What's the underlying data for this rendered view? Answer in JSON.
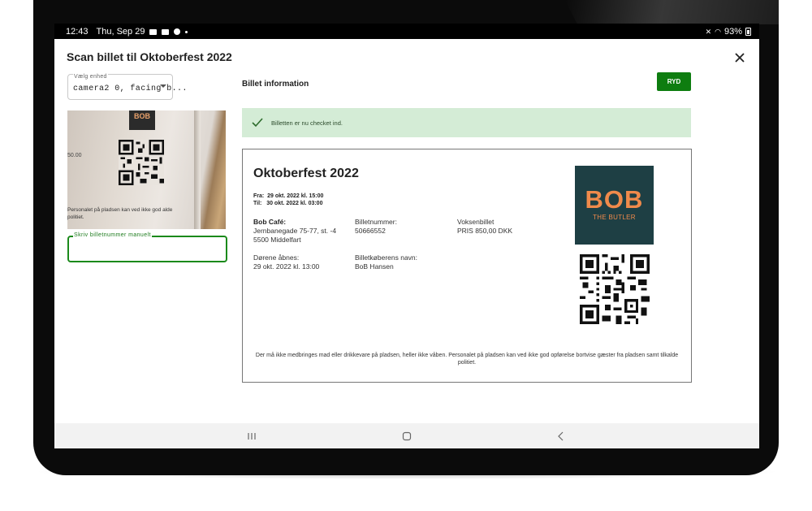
{
  "status_bar": {
    "time": "12:43",
    "date": "Thu, Sep 29",
    "battery": "93%"
  },
  "dialog": {
    "title": "Scan billet til Oktoberfest 2022"
  },
  "device_select": {
    "label": "Vælg enhed",
    "value": "camera2 0, facing b..."
  },
  "camera_preview": {
    "price_fragment": "50.00",
    "text_fragment": "Personalet på pladsen kan ved ikke god alde politiet.",
    "logo_text": "BOB"
  },
  "manual_input": {
    "label": "Skriv billetnummer manuelt",
    "value": ""
  },
  "ticket_panel": {
    "heading": "Billet information",
    "clear_button": "RYD",
    "alert_message": "Billetten er nu checket ind."
  },
  "ticket": {
    "event_title": "Oktoberfest 2022",
    "from": "Fra:  29 okt. 2022 kl. 15:00",
    "to": "Til:   30 okt. 2022 kl. 03:00",
    "venue_name": "Bob Café:",
    "venue_address1": "Jernbanegade 75-77, st. -4",
    "venue_address2": "5500 Middelfart",
    "ticket_number_label": "Billetnummer:",
    "ticket_number": "50666552",
    "ticket_type": "Voksenbillet",
    "price": "PRIS 850,00 DKK",
    "doors_label": "Dørene åbnes:",
    "doors_time": "29 okt. 2022 kl. 13:00",
    "buyer_label": "Billetkøberens navn:",
    "buyer_name": "BoB Hansen",
    "logo_main": "BOB",
    "logo_sub": "THE BUTLER",
    "footer": "Der må ikke medbringes mad eller drikkevare på pladsen, heller ikke våben. Personalet på pladsen kan ved ikke god opførelse bortvise gæster fra pladsen samt tilkalde politiet."
  },
  "colors": {
    "accent_green": "#0e7d10",
    "alert_bg": "#d4ecd6",
    "logo_bg": "#1e3f44",
    "logo_orange": "#f08a4b"
  },
  "icons": {
    "close": "close-icon",
    "check": "check-icon",
    "dropdown": "chevron-down-icon",
    "nav_recents": "recents-icon",
    "nav_home": "home-icon",
    "nav_back": "back-icon"
  }
}
